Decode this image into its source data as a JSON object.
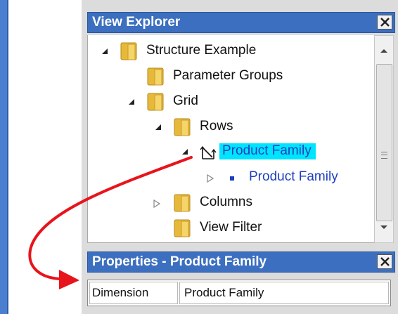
{
  "view_explorer": {
    "title": "View Explorer",
    "close_icon": "close-icon",
    "tree": [
      {
        "label": "Structure Example",
        "state": "expanded",
        "icon": "folder-icon"
      },
      {
        "label": "Parameter Groups",
        "state": "leaf",
        "icon": "folder-icon"
      },
      {
        "label": "Grid",
        "state": "expanded",
        "icon": "folder-icon"
      },
      {
        "label": "Rows",
        "state": "expanded",
        "icon": "folder-icon"
      },
      {
        "label": "Product Family",
        "state": "expanded",
        "icon": "dimension-icon",
        "selected": true
      },
      {
        "label": "Product Family",
        "state": "collapsed",
        "icon": "member-bullet-icon"
      },
      {
        "label": "Columns",
        "state": "collapsed",
        "icon": "folder-icon"
      },
      {
        "label": "View Filter",
        "state": "leaf",
        "icon": "folder-icon"
      }
    ]
  },
  "properties": {
    "title": "Properties - Product Family",
    "close_icon": "close-icon",
    "rows": [
      {
        "key": "Dimension",
        "value": "Product Family"
      }
    ]
  },
  "colors": {
    "titlebar": "#3c6fbf",
    "selection_highlight": "#00e5ff",
    "selected_text": "#1c3fbf",
    "annotation_arrow": "#e8141b"
  },
  "annotation": {
    "type": "curved-arrow",
    "from": "selected tree item",
    "to": "properties dimension row"
  }
}
